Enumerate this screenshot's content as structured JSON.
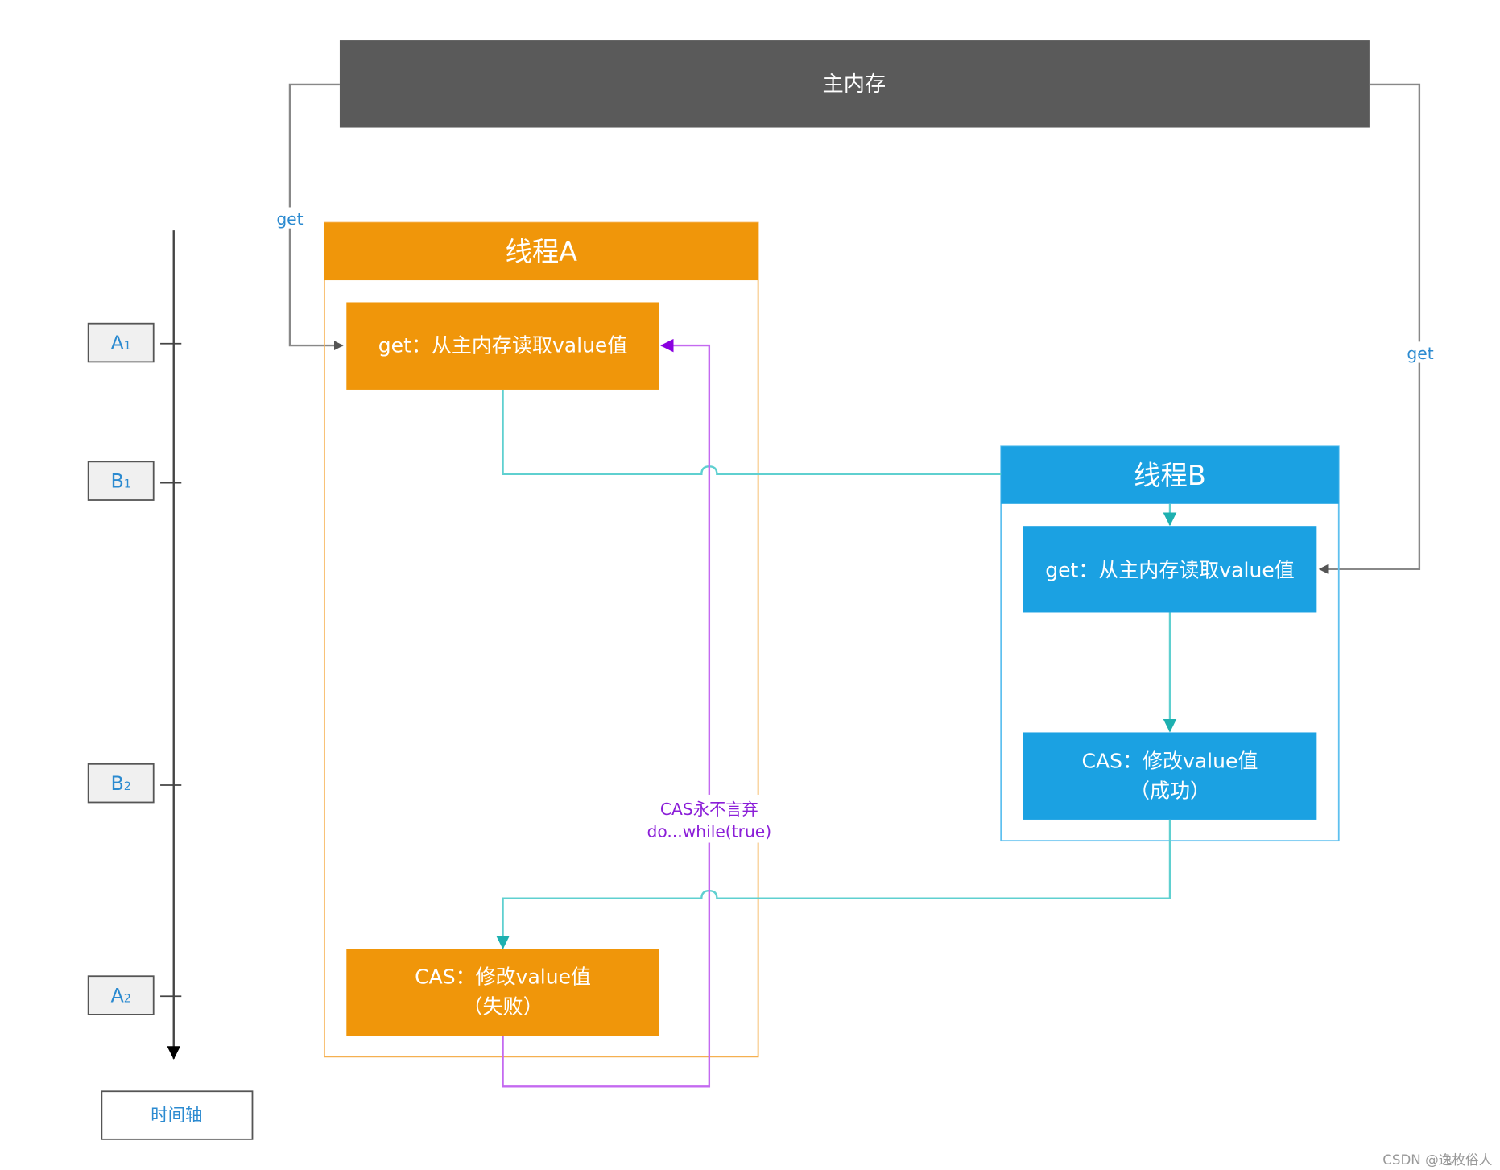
{
  "main_memory": {
    "label": "主内存"
  },
  "get_left_label": "get",
  "get_right_label": "get",
  "thread_a": {
    "title": "线程A",
    "get_box": "get：从主内存读取value值",
    "cas_box_line1": "CAS：修改value值",
    "cas_box_line2": "（失败）"
  },
  "thread_b": {
    "title": "线程B",
    "get_box": "get：从主内存读取value值",
    "cas_box_line1": "CAS：修改value值",
    "cas_box_line2": "（成功）"
  },
  "retry_label_line1": "CAS永不言弃",
  "retry_label_line2": "do...while(true)",
  "timeline": {
    "label": "时间轴",
    "markers": [
      {
        "letter": "A",
        "sub": "1"
      },
      {
        "letter": "B",
        "sub": "1"
      },
      {
        "letter": "B",
        "sub": "2"
      },
      {
        "letter": "A",
        "sub": "2"
      }
    ]
  },
  "watermark": "CSDN @逸枚俗人",
  "colors": {
    "main_memory": "#5a5a5a",
    "thread_a": "#f0960a",
    "thread_b": "#1ba1e2",
    "flow": "#3cc6c6",
    "retry": "#b04de8",
    "label_text": "#2b8ad0"
  }
}
